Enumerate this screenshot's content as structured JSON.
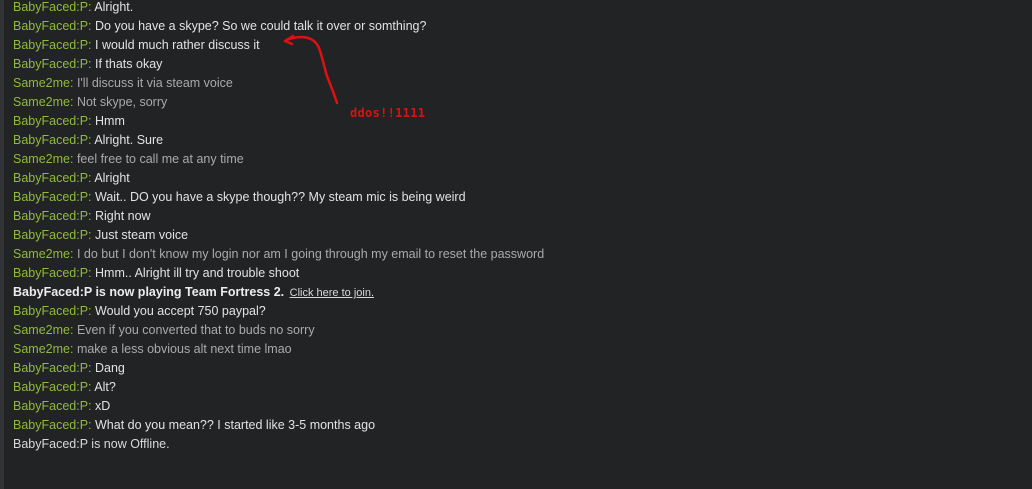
{
  "annotation": {
    "text": "ddos!!1111",
    "color": "#dd1111"
  },
  "colors": {
    "background": "#222325",
    "name": "#90ba3c",
    "friend_text": "#e2e2e2",
    "me_text": "#aaaaaa"
  },
  "messages": [
    {
      "sender": "BabyFaced:P",
      "text": "Alright."
    },
    {
      "sender": "BabyFaced:P",
      "text": "Do you have a skype? So we could talk it over or somthing?"
    },
    {
      "sender": "BabyFaced:P",
      "text": "I would much rather discuss it"
    },
    {
      "sender": "BabyFaced:P",
      "text": "If thats okay"
    },
    {
      "sender": "Same2me",
      "text": "I'll discuss it via steam voice"
    },
    {
      "sender": "Same2me",
      "text": "Not skype, sorry"
    },
    {
      "sender": "BabyFaced:P",
      "text": "Hmm"
    },
    {
      "sender": "BabyFaced:P",
      "text": "Alright. Sure"
    },
    {
      "sender": "Same2me",
      "text": "feel free to call me at any time"
    },
    {
      "sender": "BabyFaced:P",
      "text": "Alright"
    },
    {
      "sender": "BabyFaced:P",
      "text": "Wait.. DO you have a skype though?? My steam mic is being weird"
    },
    {
      "sender": "BabyFaced:P",
      "text": "Right now"
    },
    {
      "sender": "BabyFaced:P",
      "text": "Just steam voice"
    },
    {
      "sender": "Same2me",
      "text": "I do but I don't know my login nor am I going through my email to reset the password"
    },
    {
      "sender": "BabyFaced:P",
      "text": "Hmm.. Alright ill try and trouble shoot"
    },
    {
      "status": "BabyFaced:P is now playing Team Fortress 2.",
      "link": "Click here to join."
    },
    {
      "sender": "BabyFaced:P",
      "text": "Would you accept 750 paypal?"
    },
    {
      "sender": "Same2me",
      "text": "Even if you converted that to buds no sorry"
    },
    {
      "sender": "Same2me",
      "text": "make a less obvious alt next time lmao"
    },
    {
      "sender": "BabyFaced:P",
      "text": "Dang"
    },
    {
      "sender": "BabyFaced:P",
      "text": "Alt?"
    },
    {
      "sender": "BabyFaced:P",
      "text": "xD"
    },
    {
      "sender": "BabyFaced:P",
      "text": "What do you mean?? I started like 3-5 months ago"
    },
    {
      "offline": "BabyFaced:P is now Offline."
    }
  ]
}
